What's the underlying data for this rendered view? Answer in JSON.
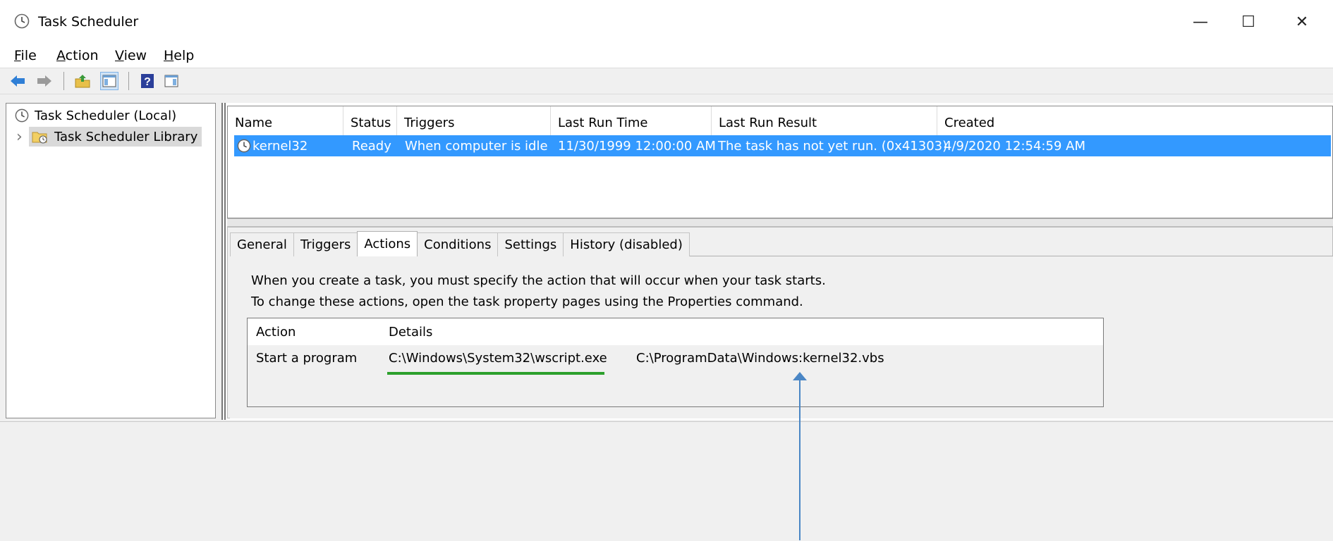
{
  "window": {
    "title": "Task Scheduler",
    "controls": {
      "minimize": "—",
      "maximize": "☐",
      "close": "✕"
    }
  },
  "menu": [
    {
      "accel": "F",
      "rest": "ile"
    },
    {
      "accel": "A",
      "rest": "ction"
    },
    {
      "accel": "V",
      "rest": "iew"
    },
    {
      "accel": "H",
      "rest": "elp"
    }
  ],
  "toolbar": {
    "buttons": [
      "back-arrow-icon",
      "forward-arrow-icon",
      "up-folder-icon",
      "show-hide-console-tree-icon",
      "help-icon",
      "show-hide-action-pane-icon"
    ]
  },
  "tree": {
    "root": "Task Scheduler (Local)",
    "child": "Task Scheduler Library",
    "expander": "›"
  },
  "tasks": {
    "columns": [
      "Name",
      "Status",
      "Triggers",
      "Last Run Time",
      "Last Run Result",
      "Created"
    ],
    "rows": [
      {
        "name": "kernel32",
        "status": "Ready",
        "triggers": "When computer is idle",
        "last_run_time": "11/30/1999 12:00:00 AM",
        "last_run_result": "The task has not yet run. (0x41303)",
        "created": "4/9/2020 12:54:59 AM"
      }
    ]
  },
  "tabs": [
    {
      "label": "General",
      "active": false
    },
    {
      "label": "Triggers",
      "active": false
    },
    {
      "label": "Actions",
      "active": true
    },
    {
      "label": "Conditions",
      "active": false
    },
    {
      "label": "Settings",
      "active": false
    },
    {
      "label": "History (disabled)",
      "active": false
    }
  ],
  "actions_tab": {
    "line1": "When you create a task, you must specify the action that will occur when your task starts.",
    "line2": "To change these actions, open the task property pages using the Properties command.",
    "columns": [
      "Action",
      "Details"
    ],
    "rows": [
      {
        "action": "Start a program",
        "program": "C:\\Windows\\System32\\wscript.exe",
        "arguments": "C:\\ProgramData\\Windows:kernel32.vbs"
      }
    ]
  },
  "colors": {
    "selection": "#3399ff",
    "underline_annotation": "#2ca02c",
    "arrow_annotation": "#4a86c5"
  }
}
